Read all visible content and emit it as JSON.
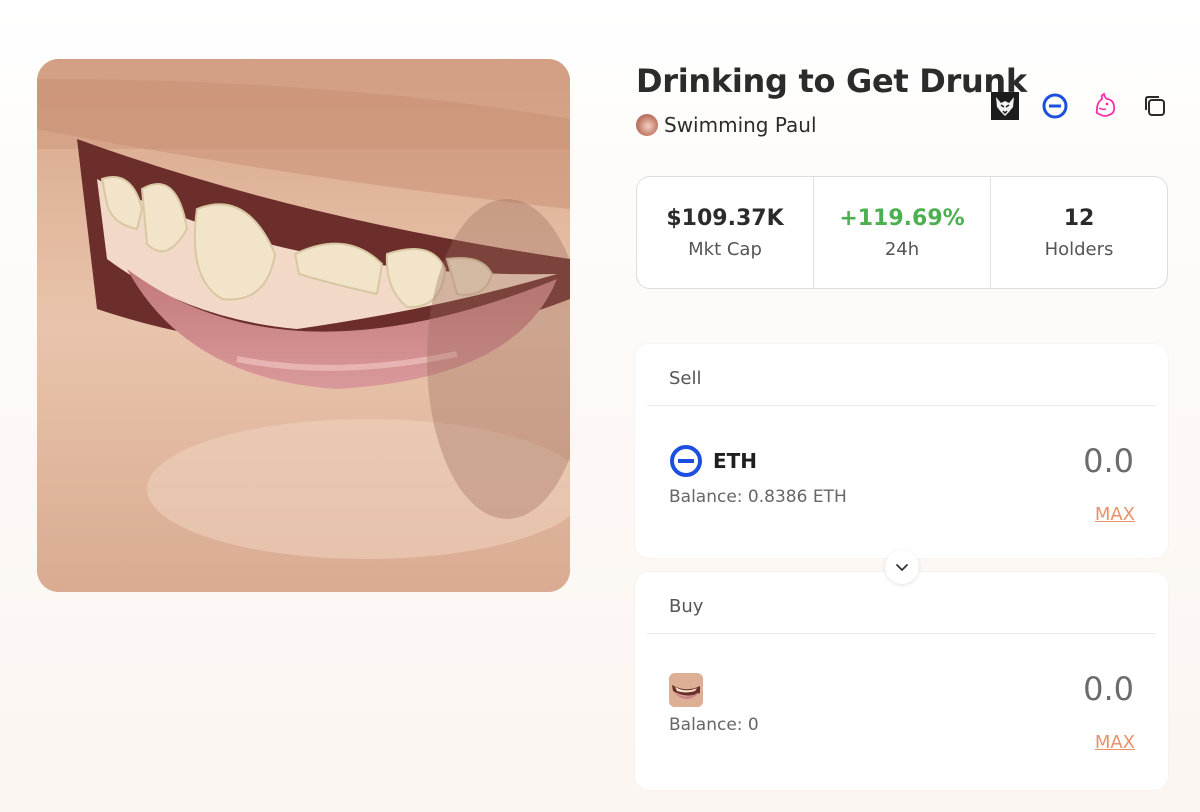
{
  "token": {
    "title": "Drinking to Get Drunk",
    "creator": "Swimming Paul"
  },
  "header_icons": [
    "wolf-icon",
    "ethereum-icon",
    "uniswap-icon",
    "copy-icon"
  ],
  "stats": [
    {
      "value": "$109.37K",
      "label": "Mkt Cap"
    },
    {
      "value": "+119.69%",
      "label": "24h"
    },
    {
      "value": "12",
      "label": "Holders"
    }
  ],
  "sell": {
    "heading": "Sell",
    "token": "ETH",
    "balance": "Balance: 0.8386 ETH",
    "amount": "0.0",
    "max_label": "MAX"
  },
  "buy": {
    "heading": "Buy",
    "balance": "Balance: 0",
    "amount": "0.0",
    "max_label": "MAX"
  },
  "colors": {
    "positive": "#4caf50",
    "max_link": "#e8916a",
    "eth_blue": "#1c4fe0",
    "uniswap_pink": "#ff2fa8"
  }
}
